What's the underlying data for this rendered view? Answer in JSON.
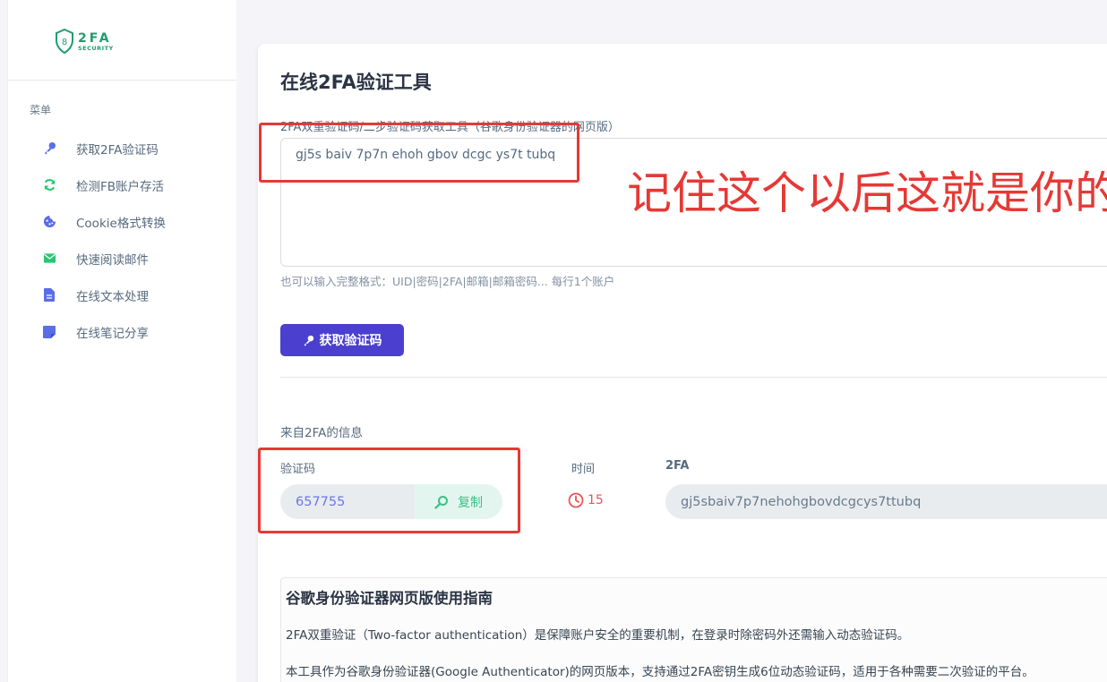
{
  "logo": {
    "big_text": "2FA",
    "small_text": "SECURITY",
    "shield_digit": "8"
  },
  "sidebar": {
    "menu_title": "菜单",
    "items": [
      {
        "label": "获取2FA验证码",
        "icon": "key-icon",
        "color": "#5a6ee8"
      },
      {
        "label": "检测FB账户存活",
        "icon": "refresh-icon",
        "color": "#28c76f"
      },
      {
        "label": "Cookie格式转换",
        "icon": "cookie-icon",
        "color": "#5a6ee8"
      },
      {
        "label": "快速阅读邮件",
        "icon": "envelope-icon",
        "color": "#28c76f"
      },
      {
        "label": "在线文本处理",
        "icon": "file-text-icon",
        "color": "#5a6ee8"
      },
      {
        "label": "在线笔记分享",
        "icon": "sticky-note-icon",
        "color": "#5a6ee8"
      }
    ]
  },
  "main": {
    "title": "在线2FA验证工具",
    "input_label": "2FA双重验证码/二步验证码获取工具（谷歌身份验证器的网页版）",
    "input_value": "gj5s baiv 7p7n ehoh gbov dcgc ys7t tubq",
    "hint": "也可以输入完整格式：UID|密码|2FA|邮箱|邮箱密码... 每行1个账户",
    "get_button": "获取验证码",
    "annotation": "记住这个以后这就是你的"
  },
  "result": {
    "section_label": "来自2FA的信息",
    "code_label": "验证码",
    "time_label": "时间",
    "secret_label": "2FA",
    "code_value": "657755",
    "copy_label": "复制",
    "time_value": "15",
    "secret_value": "gj5sbaiv7p7nehohgbovdcgcys7ttubq"
  },
  "guide": {
    "title": "谷歌身份验证器网页版使用指南",
    "p1": "2FA双重验证（Two-factor authentication）是保障账户安全的重要机制，在登录时除密码外还需输入动态验证码。",
    "p2": "本工具作为谷歌身份验证器(Google Authenticator)的网页版本，支持通过2FA密钥生成6位动态验证码，适用于各种需要二次验证的平台。"
  },
  "colors": {
    "accent": "#4a3fcf",
    "annotation_red": "#e53935",
    "copy_green": "#3cbf86",
    "timer_red": "#ea5455"
  }
}
